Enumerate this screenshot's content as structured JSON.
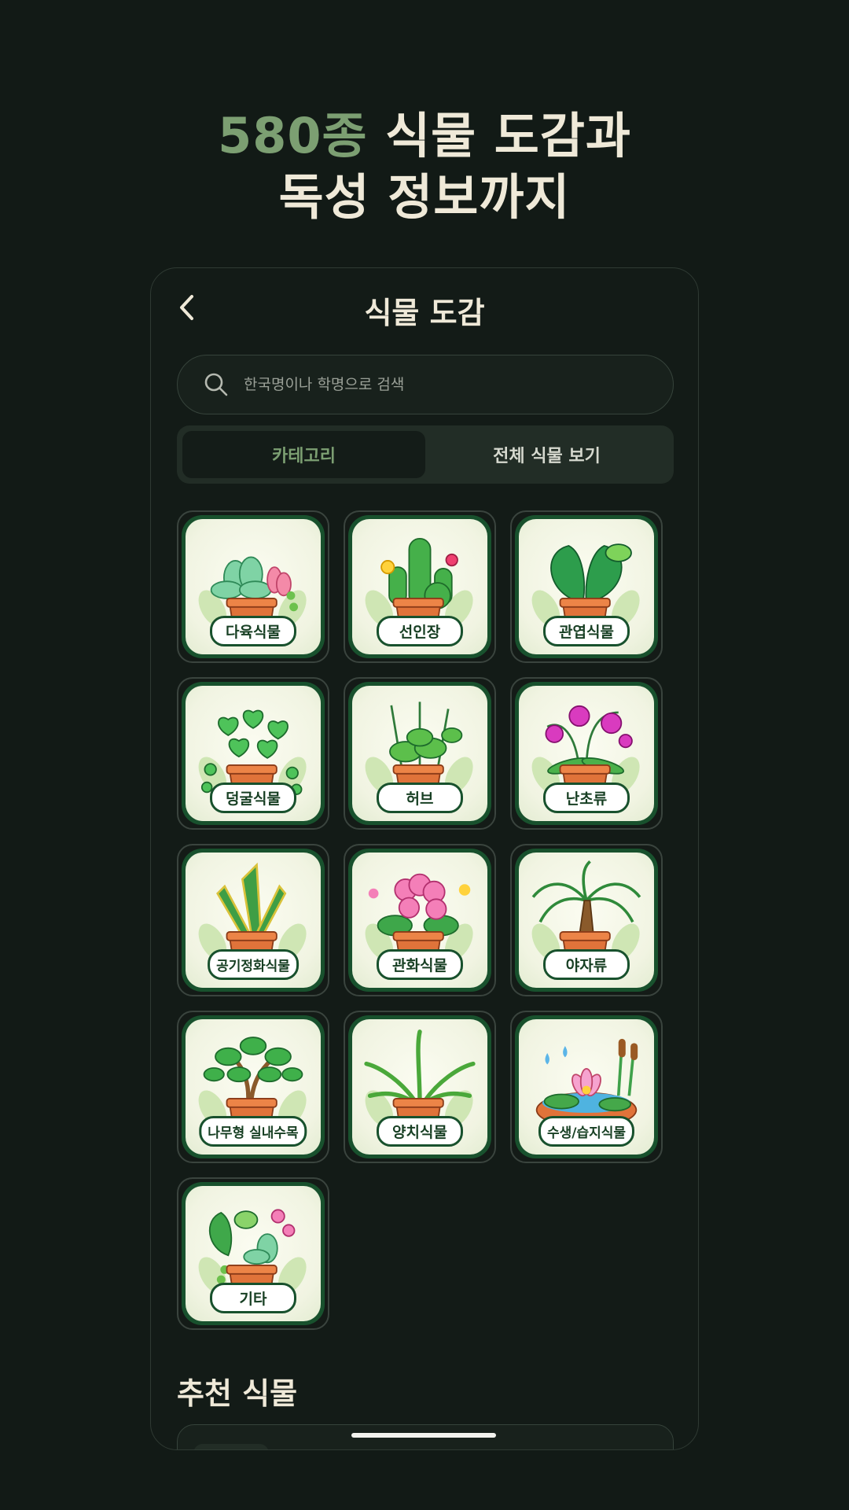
{
  "headline": {
    "line1_accent": "580종",
    "line1_rest": " 식물 도감과",
    "line2": "독성 정보까지"
  },
  "topbar": {
    "back_icon": "chevron-left-icon",
    "title": "식물 도감"
  },
  "search": {
    "icon": "search-icon",
    "placeholder": "한국명이나 학명으로 검색"
  },
  "tabs": [
    {
      "label": "카테고리",
      "active": true
    },
    {
      "label": "전체 식물 보기",
      "active": false
    }
  ],
  "categories": [
    {
      "label": "다육식물"
    },
    {
      "label": "선인장"
    },
    {
      "label": "관엽식물"
    },
    {
      "label": "덩굴식물"
    },
    {
      "label": "허브"
    },
    {
      "label": "난초류"
    },
    {
      "label": "공기정화식물"
    },
    {
      "label": "관화식물"
    },
    {
      "label": "야자류"
    },
    {
      "label": "나무형 실내수목"
    },
    {
      "label": "양치식물"
    },
    {
      "label": "수생/습지식물"
    },
    {
      "label": "기타"
    }
  ],
  "recommended": {
    "title": "추천 식물"
  },
  "colors": {
    "background": "#121a16",
    "accent": "#7c9f72",
    "text": "#efe9d8",
    "card_frame": "#18512d"
  }
}
